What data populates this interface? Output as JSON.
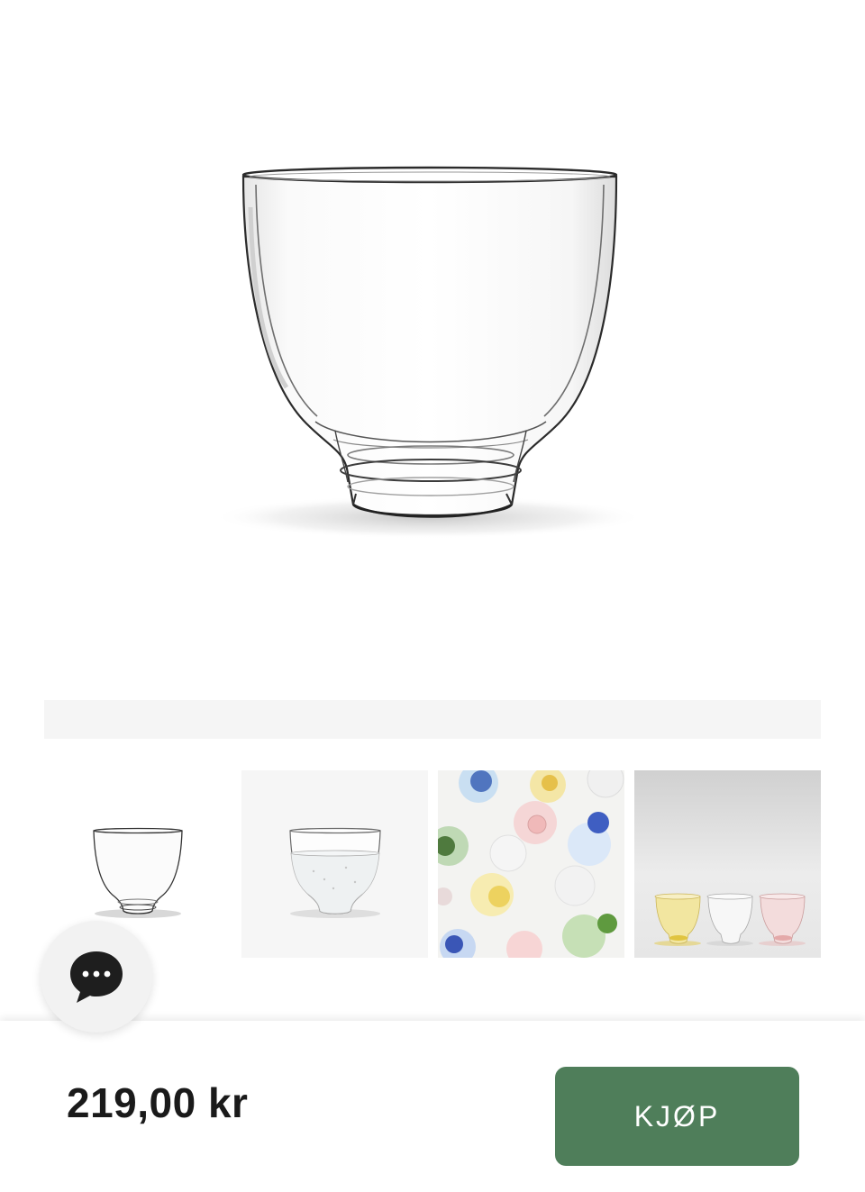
{
  "product": {
    "price": "219,00 kr"
  },
  "actions": {
    "buy_label": "KJØP"
  },
  "gallery": {
    "thumbnails": [
      "thumbnail-clear-glass",
      "thumbnail-glass-with-water",
      "thumbnail-colored-glasses-top-view",
      "thumbnail-three-colored-glasses"
    ]
  },
  "chat": {
    "icon": "chat-bubble-icon"
  },
  "colors": {
    "accent": "#4f7e5a",
    "price_text": "#1a1a1a",
    "slider_bar": "#f5f5f5",
    "chat_button_bg": "#f2f2f2"
  }
}
